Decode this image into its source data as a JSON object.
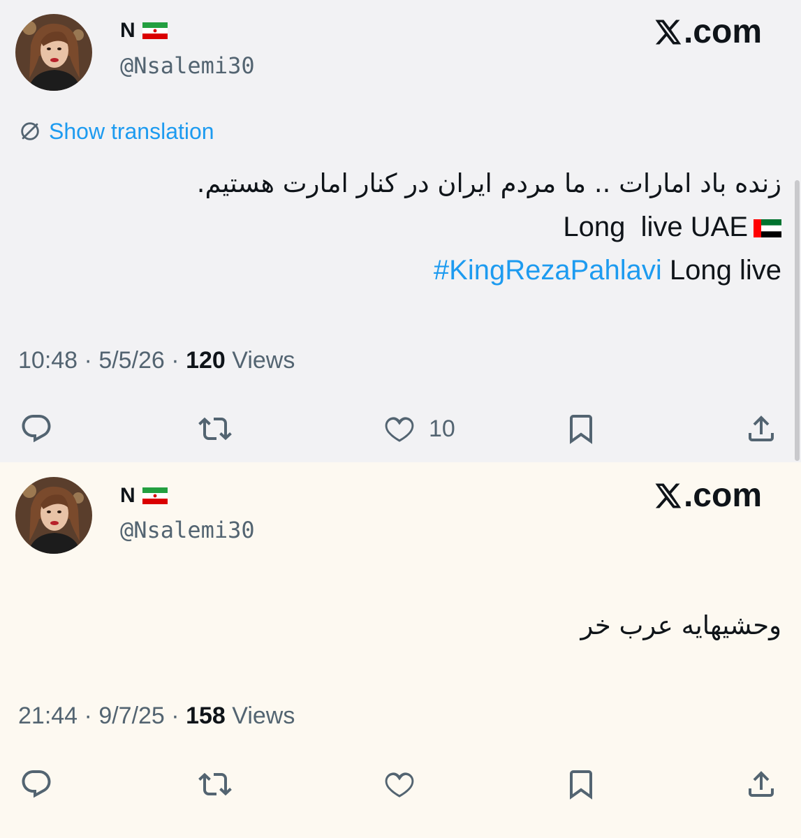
{
  "brand": {
    "label": ".com",
    "icon": "x-logo-icon"
  },
  "tweets": [
    {
      "author": {
        "name": "N",
        "handle": "@Nsalemi30",
        "flag": "iran-flag-icon"
      },
      "show_translation": "Show translation",
      "lines": {
        "persian": "زنده باد امارات .. ما مردم ایران در کنار امارت هستیم.",
        "english": "Long  live UAE",
        "hashtag": "#KingRezaPahlavi",
        "english2": " Long live"
      },
      "meta": {
        "time": "10:48",
        "date": "5/5/26",
        "views_count": "120",
        "views_label": "Views"
      },
      "actions": {
        "like_count": "10"
      }
    },
    {
      "author": {
        "name": "N",
        "handle": "@Nsalemi30",
        "flag": "iran-flag-icon"
      },
      "lines": {
        "persian": "وحشیهایه عرب خر"
      },
      "meta": {
        "time": "21:44",
        "date": "9/7/25",
        "views_count": "158",
        "views_label": "Views"
      },
      "actions": {
        "like_count": ""
      }
    }
  ],
  "colors": {
    "link": "#1d9bf0",
    "muted": "#536471",
    "text": "#0f1419",
    "bg_tweet_1": "#f2f2f4",
    "bg_tweet_2": "#fdf9f1"
  }
}
